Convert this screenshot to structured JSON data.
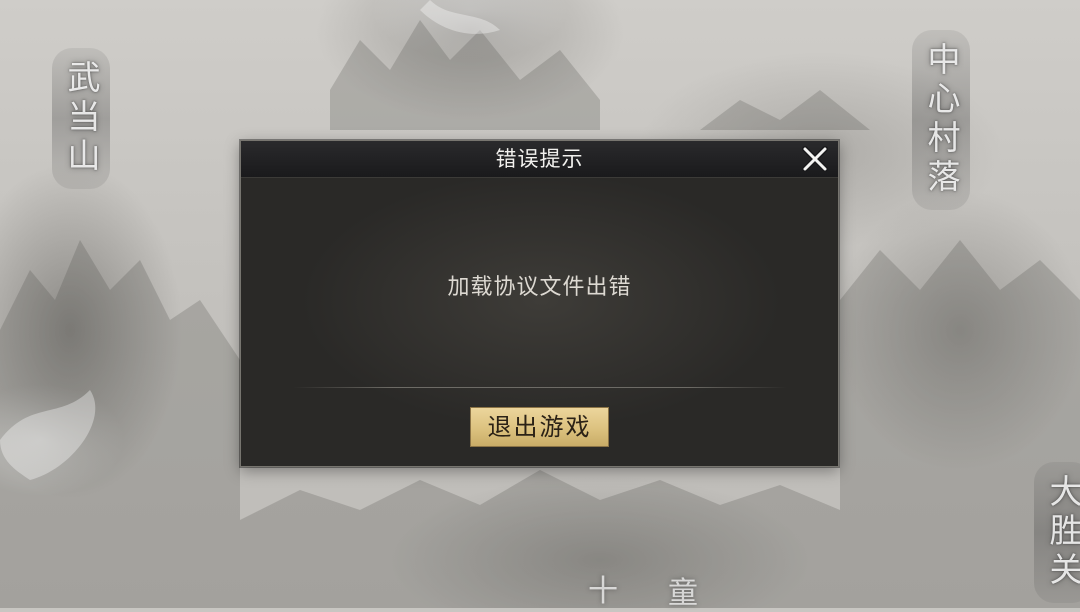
{
  "map": {
    "place_labels": [
      {
        "text": "武当山"
      },
      {
        "text": "中心村落"
      },
      {
        "text": "大胜关"
      }
    ],
    "partial_labels": [
      {
        "text": "十"
      },
      {
        "text": "童"
      }
    ]
  },
  "dialog": {
    "title": "错误提示",
    "message": "加载协议文件出错",
    "exit_button_label": "退出游戏",
    "close_icon": "close-x-icon"
  },
  "colors": {
    "dialog_background": "#2f2e2b",
    "header_background": "#1a1a1c",
    "button_gold": "#dcc27f",
    "title_text": "#f2f1ee",
    "message_text": "#ddd9d2"
  }
}
